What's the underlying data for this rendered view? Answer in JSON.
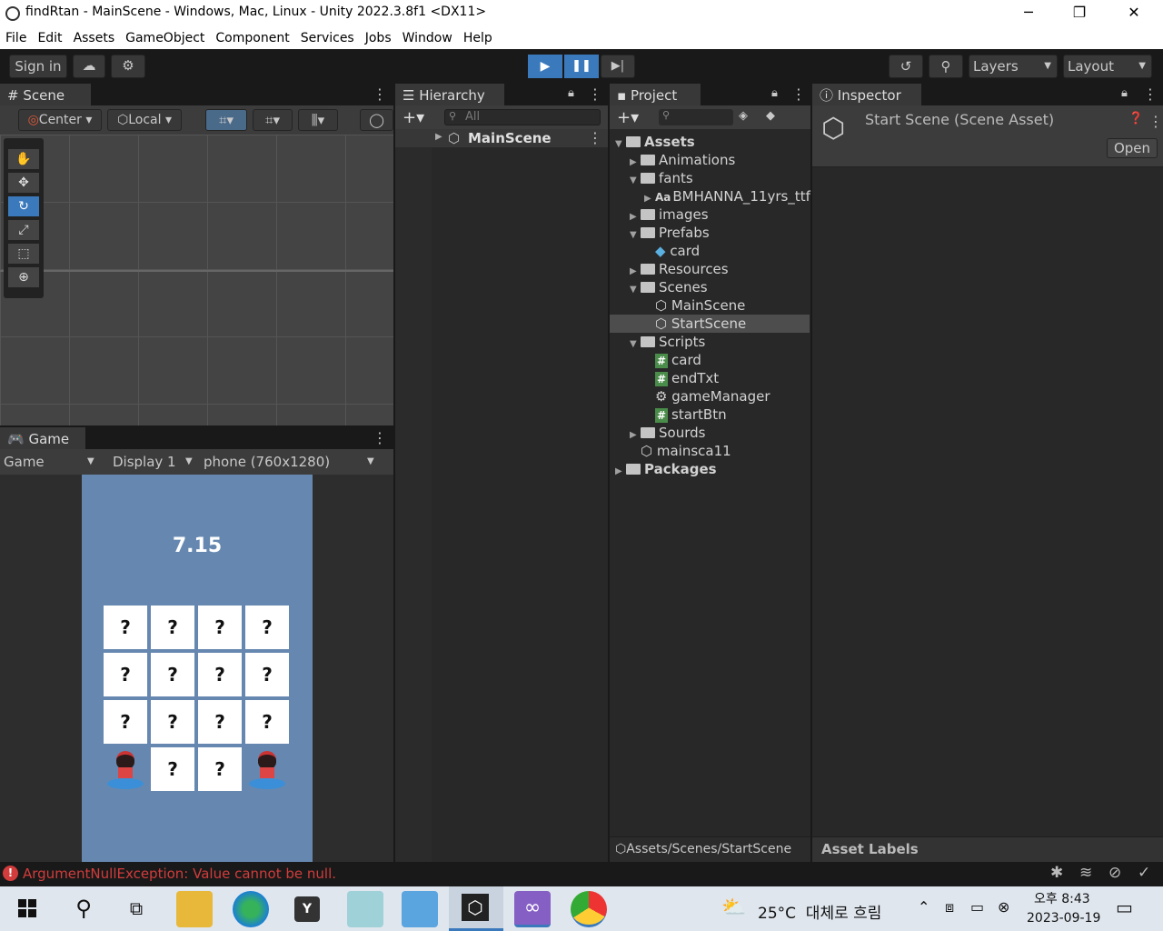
{
  "window": {
    "title": "findRtan - MainScene - Windows, Mac, Linux - Unity 2022.3.8f1 <DX11>",
    "minimize": "─",
    "maximize": "❐",
    "close": "✕"
  },
  "menu": [
    "File",
    "Edit",
    "Assets",
    "GameObject",
    "Component",
    "Services",
    "Jobs",
    "Window",
    "Help"
  ],
  "toolbar": {
    "sign_in": "Sign in",
    "layers": "Layers",
    "layout": "Layout"
  },
  "scene": {
    "tab": "Scene",
    "center": "Center",
    "local": "Local"
  },
  "hierarchy": {
    "tab": "Hierarchy",
    "search_placeholder": "All",
    "root": "MainScene"
  },
  "project": {
    "tab": "Project",
    "items": [
      {
        "label": "Assets",
        "kind": "folder",
        "depth": 0,
        "expanded": true,
        "bold": true
      },
      {
        "label": "Animations",
        "kind": "folder",
        "depth": 1,
        "expanded": false
      },
      {
        "label": "fants",
        "kind": "folder",
        "depth": 1,
        "expanded": true
      },
      {
        "label": "BMHANNA_11yrs_ttf",
        "kind": "font",
        "depth": 2,
        "expanded": false
      },
      {
        "label": "images",
        "kind": "folder",
        "depth": 1,
        "expanded": false
      },
      {
        "label": "Prefabs",
        "kind": "folder",
        "depth": 1,
        "expanded": true
      },
      {
        "label": "card",
        "kind": "prefab",
        "depth": 2
      },
      {
        "label": "Resources",
        "kind": "folder",
        "depth": 1,
        "expanded": false
      },
      {
        "label": "Scenes",
        "kind": "folder",
        "depth": 1,
        "expanded": true
      },
      {
        "label": "MainScene",
        "kind": "scene",
        "depth": 2
      },
      {
        "label": "StartScene",
        "kind": "scene",
        "depth": 2,
        "selected": true
      },
      {
        "label": "Scripts",
        "kind": "folder",
        "depth": 1,
        "expanded": true
      },
      {
        "label": "card",
        "kind": "script",
        "depth": 2
      },
      {
        "label": "endTxt",
        "kind": "script",
        "depth": 2
      },
      {
        "label": "gameManager",
        "kind": "gear",
        "depth": 2
      },
      {
        "label": "startBtn",
        "kind": "script",
        "depth": 2
      },
      {
        "label": "Sourds",
        "kind": "folder",
        "depth": 1,
        "expanded": false
      },
      {
        "label": "mainsca11",
        "kind": "scene",
        "depth": 1
      },
      {
        "label": "Packages",
        "kind": "folder",
        "depth": 0,
        "expanded": false,
        "bold": true
      }
    ],
    "path": "Assets/Scenes/StartScene"
  },
  "inspector": {
    "tab": "Inspector",
    "asset_title": "Start Scene (Scene Asset)",
    "open_button": "Open",
    "asset_labels": "Asset Labels"
  },
  "game": {
    "tab": "Game",
    "mode": "Game",
    "display": "Display 1",
    "resolution": "phone (760x1280)",
    "timer": "7.15",
    "cards": [
      "?",
      "?",
      "?",
      "?",
      "?",
      "?",
      "?",
      "?",
      "?",
      "?",
      "?",
      "?",
      "rtan",
      "?",
      "?",
      "rtan"
    ]
  },
  "status": {
    "error": "ArgumentNullException: Value cannot be null."
  },
  "taskbar": {
    "weather": "25°C  대체로 흐림",
    "time": "오후 8:43",
    "date": "2023-09-19"
  },
  "colors": {
    "accent_blue": "#3a79bb",
    "game_bg": "#6688b0",
    "error_red": "#d23c3c"
  }
}
